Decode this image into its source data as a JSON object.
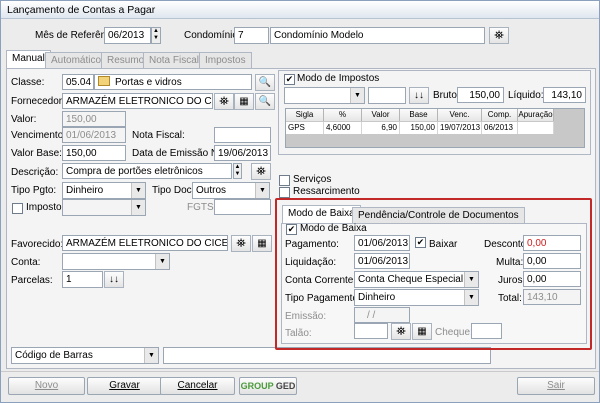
{
  "window": {
    "title": "Lançamento de Contas a Pagar"
  },
  "header": {
    "mes_label": "Mês de Referência:",
    "mes_value": "06/2013",
    "condominio_label": "Condomínio:",
    "condominio_code": "7",
    "condominio_name": "Condomínio Modelo"
  },
  "tabs": [
    "Manual",
    "Automático",
    "Resumo",
    "Nota Fiscal",
    "Impostos"
  ],
  "form": {
    "classe_label": "Classe:",
    "classe_code": "05.04",
    "classe_name": "Portas e vidros",
    "fornecedor_label": "Fornecedor:",
    "fornecedor_value": "ARMAZÉM ELETRONICO DO CICERO",
    "valor_label": "Valor:",
    "valor_value": "150,00",
    "vencimento_label": "Vencimento:",
    "vencimento_value": "01/06/2013",
    "nota_fiscal_label": "Nota Fiscal:",
    "nota_fiscal_value": "",
    "valor_base_label": "Valor Base:",
    "valor_base_value": "150,00",
    "data_emissao_label": "Data de Emissão NF:",
    "data_emissao_value": "19/06/2013",
    "descricao_label": "Descrição:",
    "descricao_value": "Compra de portões eletrônicos",
    "tipo_pgto_label": "Tipo Pgto:",
    "tipo_pgto_value": "Dinheiro",
    "tipo_doc_label": "Tipo Doc:",
    "tipo_doc_value": "Outros",
    "imposto_label": "Imposto",
    "imposto_value": "",
    "fgts_label": "FGTS:",
    "fgts_value": "",
    "favorecido_label": "Favorecido:",
    "favorecido_value": "ARMAZÉM ELETRONICO DO CICERO",
    "conta_label": "Conta:",
    "conta_value": "",
    "parcelas_label": "Parcelas:",
    "parcelas_value": "1",
    "codigo_barras_label": "Código de Barras",
    "codigo_barras_value": ""
  },
  "impostos": {
    "modo_label": "Modo de Impostos",
    "select_value": "",
    "bruto_label": "Bruto:",
    "bruto_value": "150,00",
    "liquido_label": "Líquido:",
    "liquido_value": "143,10",
    "columns": [
      "Sigla",
      "%",
      "Valor",
      "Base",
      "Venc.",
      "Comp.",
      "Apuração"
    ],
    "rows": [
      [
        "GPS",
        "4,6000",
        "6,90",
        "150,00",
        "19/07/2013",
        "06/2013",
        ""
      ]
    ]
  },
  "checks": {
    "servicos": "Serviços",
    "ressarcimento": "Ressarcimento"
  },
  "baixa": {
    "tabs": [
      "Modo de Baixa",
      "Pendência/Controle de Documentos"
    ],
    "modo_label": "Modo de Baixa",
    "pagamento_label": "Pagamento:",
    "pagamento_value": "01/06/2013",
    "baixar_label": "Baixar",
    "desconto_label": "Desconto:",
    "desconto_value": "0,00",
    "liquidacao_label": "Liquidação:",
    "liquidacao_value": "01/06/2013",
    "multa_label": "Multa:",
    "multa_value": "0,00",
    "conta_corrente_label": "Conta Corrente:",
    "conta_corrente_value": "Conta Cheque Especial",
    "juros_label": "Juros:",
    "juros_value": "0,00",
    "tipo_pagamento_label": "Tipo Pagamento:",
    "tipo_pagamento_value": "Dinheiro",
    "total_label": "Total:",
    "total_value": "143,10",
    "emissao_label": "Emissão:",
    "emissao_value": "/ /",
    "talao_label": "Talão:",
    "talao_value": "",
    "cheque_label": "Cheque:",
    "cheque_value": ""
  },
  "footer": {
    "novo": "Novo",
    "gravar": "Gravar",
    "cancelar": "Cancelar",
    "ged_group": "GROUP",
    "ged": "GED",
    "sair": "Sair"
  },
  "colors": {
    "red_highlight": "#c22828",
    "red_text": "#d02020"
  }
}
